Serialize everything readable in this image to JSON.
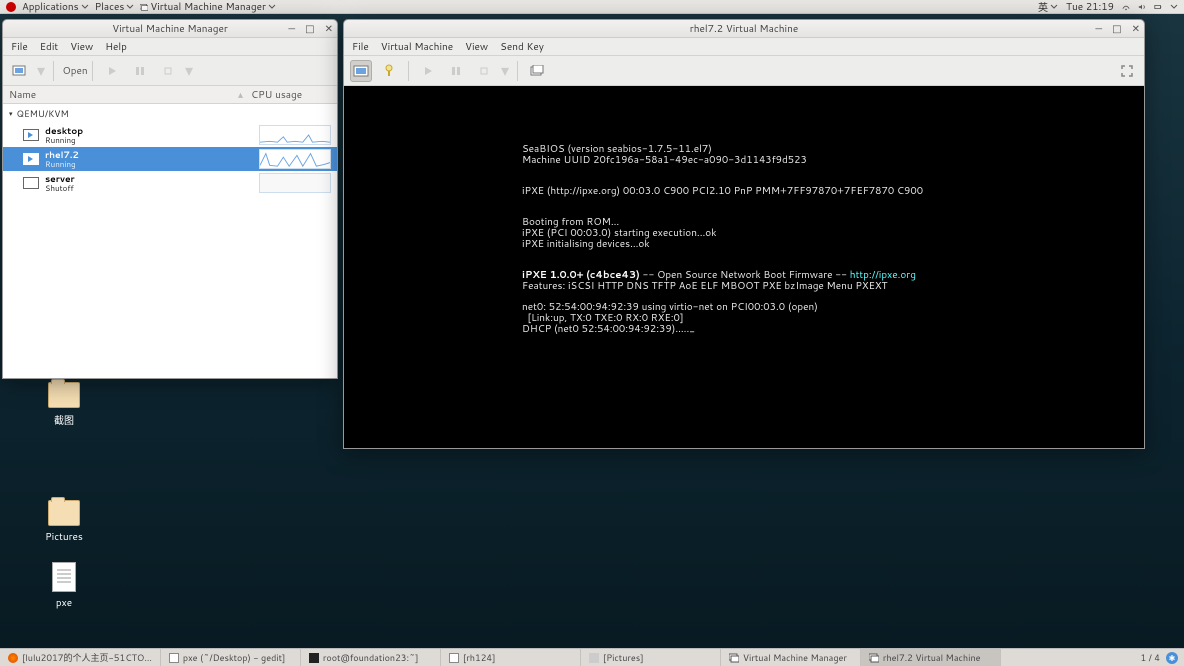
{
  "topbar": {
    "apps": "Applications",
    "places": "Places",
    "appmenu": "Virtual Machine Manager",
    "ime": "英",
    "clock": "Tue 21:19"
  },
  "desktop": {
    "screenshot": "截图",
    "pictures": "Pictures",
    "pxe": "pxe"
  },
  "vmm": {
    "title": "Virtual Machine Manager",
    "menu": {
      "file": "File",
      "edit": "Edit",
      "view": "View",
      "help": "Help"
    },
    "toolbar": {
      "open": "Open"
    },
    "columns": {
      "name": "Name",
      "cpu": "CPU usage"
    },
    "group": "QEMU/KVM",
    "rows": [
      {
        "name": "desktop",
        "state": "Running",
        "running": true,
        "selected": false
      },
      {
        "name": "rhel7.2",
        "state": "Running",
        "running": true,
        "selected": true
      },
      {
        "name": "server",
        "state": "Shutoff",
        "running": false,
        "selected": false
      }
    ]
  },
  "vmcon": {
    "title": "rhel7.2 Virtual Machine",
    "menu": {
      "file": "File",
      "vm": "Virtual Machine",
      "view": "View",
      "sendkey": "Send Key"
    },
    "console": {
      "l1": "SeaBIOS (version seabios-1.7.5-11.el7)",
      "l2": "Machine UUID 20fc196a-58a1-49ec-a090-3d1143f9d523",
      "l3": "iPXE (http://ipxe.org) 00:03.0 C900 PCI2.10 PnP PMM+7FF97870+7FEF7870 C900",
      "l4": "Booting from ROM...",
      "l5": "iPXE (PCI 00:03.0) starting execution...ok",
      "l6": "iPXE initialising devices...ok",
      "l7a": "iPXE 1.0.0+ (c4bce43)",
      "l7b": " -- Open Source Network Boot Firmware -- ",
      "l7c": "http://ipxe.org",
      "l8": "Features: iSCSI HTTP DNS TFTP AoE ELF MBOOT PXE bzImage Menu PXEXT",
      "l9": "net0: 52:54:00:94:92:39 using virtio-net on PCI00:03.0 (open)",
      "l10": "  [Link:up, TX:0 TXE:0 RX:0 RXE:0]",
      "l11": "DHCP (net0 52:54:00:94:92:39)....._"
    }
  },
  "taskbar": {
    "t1": "[lulu2017的个人主页-51CTO…",
    "t2": "pxe (~/Desktop) - gedit]",
    "t3": "root@foundation23:~]",
    "t4": "[rh124]",
    "t5": "[Pictures]",
    "t6": "Virtual Machine Manager",
    "t7": "rhel7.2 Virtual Machine",
    "ws": "1 / 4"
  }
}
